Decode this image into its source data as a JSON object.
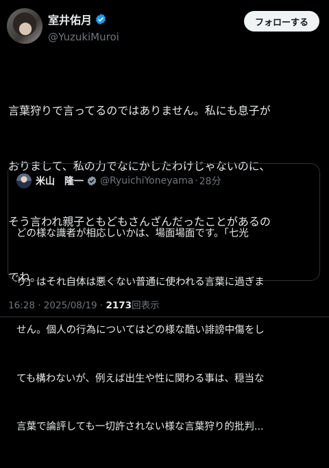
{
  "author": {
    "display_name": "室井佑月",
    "handle": "@YuzukiMuroi"
  },
  "follow_button": "フォローする",
  "tweet_lines": [
    "言葉狩りで言ってるのではありません。私にも息子が",
    "おりまして、私の力でなにかしたわけじゃないのに、",
    "そう言われ親子ともどもさんざんだったことがあるの",
    "でね。"
  ],
  "quote": {
    "display_name": "米山　隆一",
    "handle": "@RyuichiYoneyama",
    "time": "28分",
    "lines": [
      "どの様な識者が相応しいかは、場面場面です。「七光",
      "り」はそれ自体は悪くない普通に使われる言葉に過ぎま",
      "せん。個人の行為についてはどの様な酷い誹謗中傷をし",
      "ても構わないが、例えば出生や性に関わる事は、穏当な",
      "言葉で論評しても一切許されない様な言葉狩り的批判..."
    ]
  },
  "meta": {
    "time": "16:28",
    "date": "2025/08/19",
    "views": "2173",
    "views_label": "回表示",
    "separator": "·"
  },
  "colors": {
    "verified": "#1d9bf0",
    "background": "#000000",
    "text": "#e7e9ea",
    "muted": "#71767b"
  }
}
